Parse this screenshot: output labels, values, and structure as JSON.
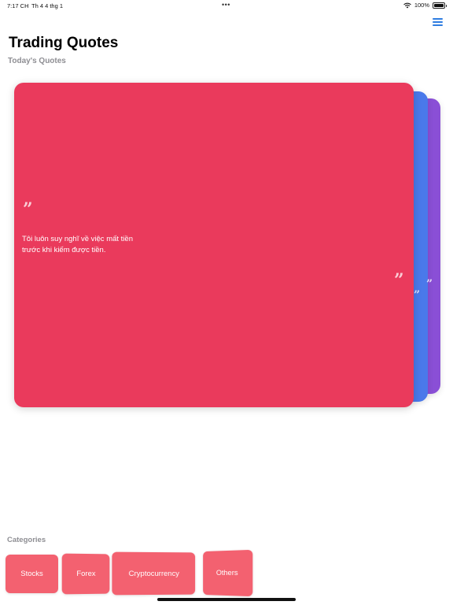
{
  "status_bar": {
    "time": "7:17 CH",
    "date": "Th 4 4 thg 1",
    "dots": "•••",
    "battery": "100%"
  },
  "header": {
    "title": "Trading Quotes",
    "subtitle": "Today's Quotes"
  },
  "quote": {
    "open_mark": "”",
    "text": "Tôi luôn suy nghĩ về việc mất tiền trước khi kiếm được tiền.",
    "close_mark": "”",
    "card_colors": [
      "#ea3a5c",
      "#4a79ea",
      "#8a4fd6"
    ]
  },
  "categories": {
    "label": "Categories",
    "items": [
      {
        "label": "Stocks"
      },
      {
        "label": "Forex"
      },
      {
        "label": "Cryptocurrency"
      },
      {
        "label": "Others"
      }
    ],
    "color": "#f36170"
  },
  "colors": {
    "accent": "#2f7de1"
  }
}
